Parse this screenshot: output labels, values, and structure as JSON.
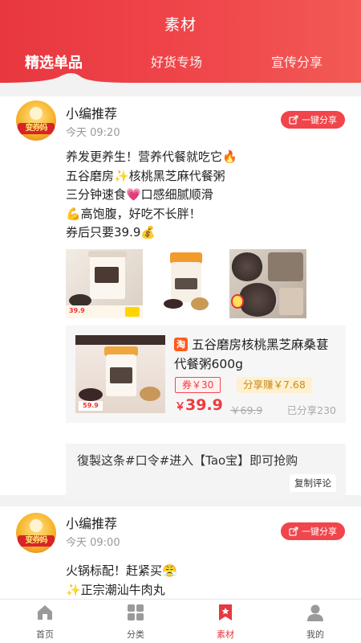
{
  "header": {
    "title": "素材",
    "tabs": [
      {
        "label": "精选单品",
        "active": true
      },
      {
        "label": "好货专场",
        "active": false
      },
      {
        "label": "宣传分享",
        "active": false
      }
    ]
  },
  "colors": {
    "accent": "#e8373f",
    "price": "#f03a3f",
    "earn_bg": "#fff0cf"
  },
  "posts": [
    {
      "avatar_text": "变券妈",
      "author": "小编推荐",
      "time": "今天 09:20",
      "share_label": "一键分享",
      "lines": [
        "养发更养生！营养代餐就吃它🔥",
        "五谷磨房✨核桃黑芝麻代餐粥",
        "三分钟速食💗口感细腻顺滑",
        "💪高饱腹，好吃不长胖！",
        "券后只要39.9💰"
      ],
      "product": {
        "platform_icon": "淘",
        "title": "五谷磨房核桃黑芝麻桑葚代餐粥600g",
        "coupon": "券￥30",
        "earn": "分享赚￥7.68",
        "price_symbol": "￥",
        "price": "39.9",
        "original_price": "￥69.9",
        "shared_count": "已分享230"
      },
      "command_text": "復製这条#口令#进入【Tao宝】即可抢购",
      "copy_comment_label": "复制评论"
    },
    {
      "avatar_text": "变券妈",
      "author": "小编推荐",
      "time": "今天 09:00",
      "share_label": "一键分享",
      "lines": [
        "火锅标配！赶紧买😤",
        "✨正宗潮汕牛肉丸"
      ]
    }
  ],
  "bottom_nav": [
    {
      "label": "首页",
      "icon": "home-icon",
      "active": false
    },
    {
      "label": "分类",
      "icon": "category-icon",
      "active": false
    },
    {
      "label": "素材",
      "icon": "material-icon",
      "active": true
    },
    {
      "label": "我的",
      "icon": "profile-icon",
      "active": false
    }
  ]
}
